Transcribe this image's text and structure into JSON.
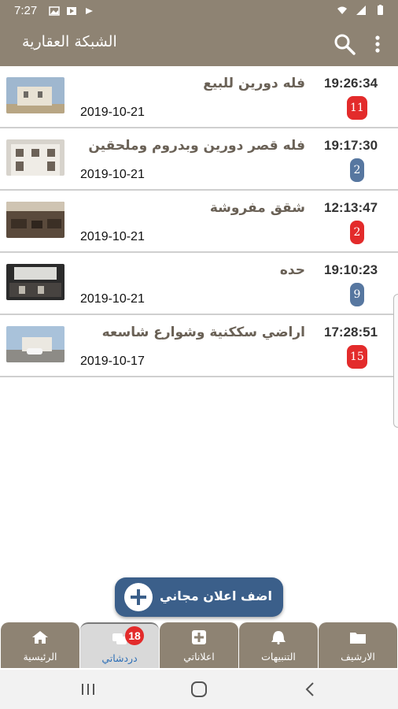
{
  "status_bar": {
    "time": "7:27",
    "left_icons": [
      "image-icon",
      "video-icon",
      "youtube-icon"
    ],
    "right_icons": [
      "wifi-icon",
      "signal-icon",
      "battery-icon"
    ]
  },
  "app_bar": {
    "title": "الشبكة العقارية",
    "icons": [
      "search-icon",
      "more-vert-icon"
    ]
  },
  "listings": [
    {
      "title": "فله دورين للبيع",
      "date": "2019-10-21",
      "time": "19:26:34",
      "count": "11",
      "badge_color": "#e32b2b"
    },
    {
      "title": "فله قصر دورين وبدروم وملحقين",
      "date": "2019-10-21",
      "time": "19:17:30",
      "count": "2",
      "badge_color": "#5777a0"
    },
    {
      "title": "شقق مفروشة",
      "date": "2019-10-21",
      "time": "12:13:47",
      "count": "2",
      "badge_color": "#e32b2b"
    },
    {
      "title": "حده",
      "date": "2019-10-21",
      "time": "19:10:23",
      "count": "9",
      "badge_color": "#5777a0"
    },
    {
      "title": "اراضي سككنية وشوارع شاسعه",
      "date": "2019-10-17",
      "time": "17:28:51",
      "count": "15",
      "badge_color": "#e32b2b"
    }
  ],
  "fab": {
    "label": "اضف اعلان مجاني",
    "icon": "plus-icon"
  },
  "bottom_nav": {
    "tabs": [
      {
        "label": "الرئيسية",
        "icon": "home-icon"
      },
      {
        "label": "دردشاتي",
        "icon": "chat-icon",
        "badge": "18",
        "active": true
      },
      {
        "label": "اعلاناتي",
        "icon": "add-box-icon"
      },
      {
        "label": "التنبيهات",
        "icon": "bell-icon"
      },
      {
        "label": "الارشيف",
        "icon": "folder-icon"
      }
    ]
  },
  "system_nav": {
    "icons": [
      "recents-icon",
      "home-button-icon",
      "back-icon"
    ]
  },
  "colors": {
    "primary": "#8e8373",
    "accent": "#3b5f8a",
    "badge_red": "#e32b2b",
    "badge_blue": "#5777a0"
  }
}
